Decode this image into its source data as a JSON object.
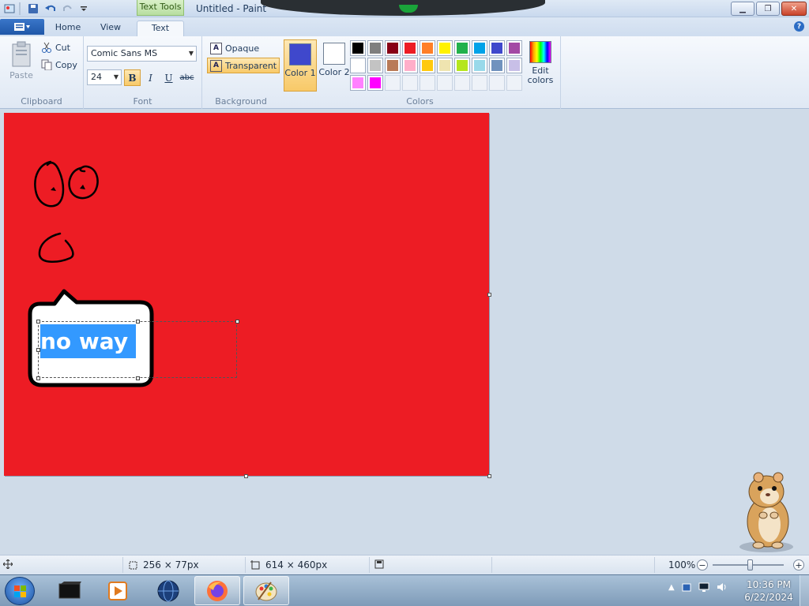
{
  "window": {
    "title": "Untitled - Paint",
    "context_tab": "Text Tools"
  },
  "tabs": [
    "Home",
    "View",
    "Text"
  ],
  "active_tab": "Text",
  "clipboard": {
    "paste_label": "Paste",
    "cut_label": "Cut",
    "copy_label": "Copy",
    "group_label": "Clipboard"
  },
  "font": {
    "family": "Comic Sans MS",
    "size": "24",
    "bold_label": "B",
    "italic_label": "I",
    "underline_label": "U",
    "strike_label": "abc",
    "bold_active": true,
    "group_label": "Font"
  },
  "background": {
    "opaque_label": "Opaque",
    "transparent_label": "Transparent",
    "selected": "Transparent",
    "group_label": "Background"
  },
  "colors": {
    "color1_label": "Color 1",
    "color2_label": "Color 2",
    "color1_value": "#3f48cc",
    "color2_value": "#ffffff",
    "edit_label": "Edit colors",
    "group_label": "Colors",
    "palette": [
      "#000000",
      "#7f7f7f",
      "#880015",
      "#ed1c24",
      "#ff7f27",
      "#fff200",
      "#22b14c",
      "#00a2e8",
      "#3f48cc",
      "#a349a4",
      "#ffffff",
      "#c3c3c3",
      "#b97a57",
      "#ffaec9",
      "#ffc90e",
      "#efe4b0",
      "#b5e61d",
      "#99d9ea",
      "#7092be",
      "#c8bfe7",
      "#ff80ff",
      "#ff00ff",
      "",
      "",
      "",
      "",
      "",
      "",
      "",
      ""
    ]
  },
  "canvas": {
    "background_color": "#ed1c24",
    "text_content": "no way",
    "selection_color": "#3399ff"
  },
  "status": {
    "selection_size": "256 × 77px",
    "image_size": "614 × 460px",
    "zoom": "100%"
  },
  "taskbar": {
    "time": "10:36 PM",
    "date": "6/22/2024"
  }
}
